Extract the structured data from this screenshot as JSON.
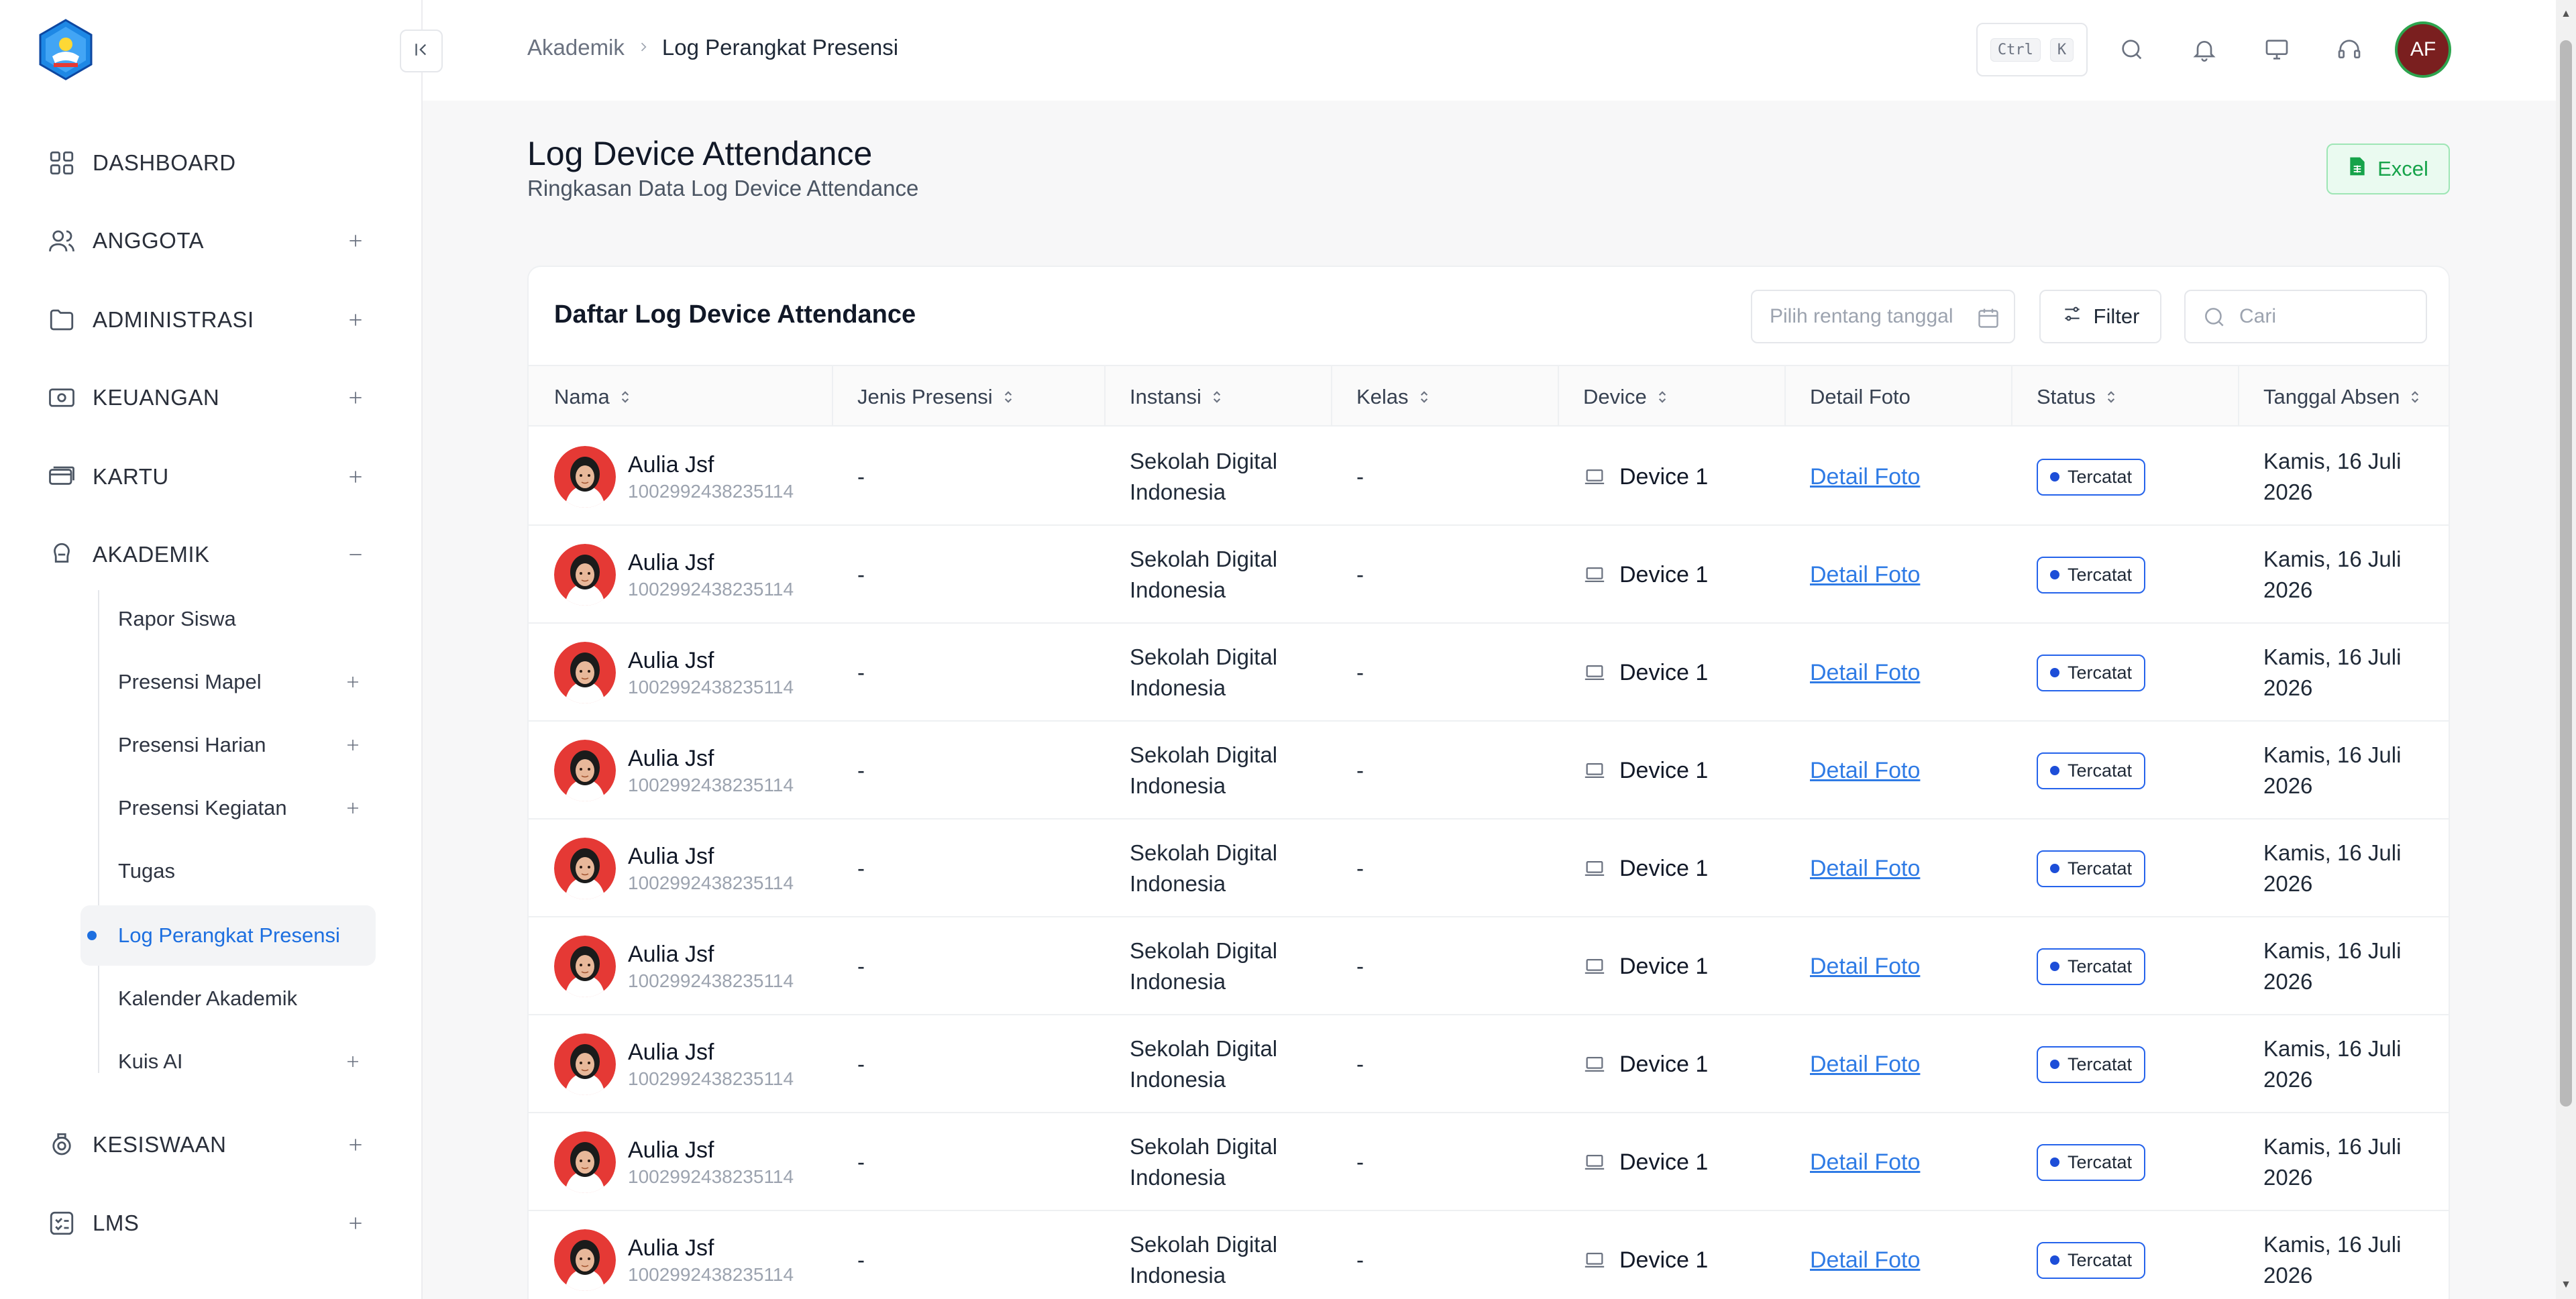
{
  "sidebar": {
    "items": [
      {
        "key": "dashboard",
        "label": "DASHBOARD",
        "expandable": false
      },
      {
        "key": "anggota",
        "label": "ANGGOTA",
        "expandable": true
      },
      {
        "key": "administrasi",
        "label": "ADMINISTRASI",
        "expandable": true
      },
      {
        "key": "keuangan",
        "label": "KEUANGAN",
        "expandable": true
      },
      {
        "key": "kartu",
        "label": "KARTU",
        "expandable": true
      },
      {
        "key": "akademik",
        "label": "AKADEMIK",
        "expandable": true,
        "expanded": true
      },
      {
        "key": "kesiswaan",
        "label": "KESISWAAN",
        "expandable": true
      },
      {
        "key": "lms",
        "label": "LMS",
        "expandable": true
      }
    ],
    "akademik_sub": [
      {
        "label": "Rapor Siswa",
        "expandable": false
      },
      {
        "label": "Presensi Mapel",
        "expandable": true
      },
      {
        "label": "Presensi Harian",
        "expandable": true
      },
      {
        "label": "Presensi Kegiatan",
        "expandable": true
      },
      {
        "label": "Tugas",
        "expandable": false
      },
      {
        "label": "Log Perangkat Presensi",
        "expandable": false,
        "active": true
      },
      {
        "label": "Kalender Akademik",
        "expandable": false
      },
      {
        "label": "Kuis AI",
        "expandable": true
      }
    ]
  },
  "topbar": {
    "breadcrumb": [
      "Akademik",
      "Log Perangkat Presensi"
    ],
    "shortcut": [
      "Ctrl",
      "K"
    ],
    "avatar_initials": "AF"
  },
  "page": {
    "title": "Log Device Attendance",
    "subtitle": "Ringkasan Data Log Device Attendance",
    "excel_label": "Excel"
  },
  "table": {
    "title": "Daftar Log Device Attendance",
    "date_placeholder": "Pilih rentang tanggal",
    "filter_label": "Filter",
    "search_placeholder": "Cari",
    "columns": [
      "Nama",
      "Jenis Presensi",
      "Instansi",
      "Kelas",
      "Device",
      "Detail Foto",
      "Status",
      "Tanggal Absen"
    ],
    "rows": [
      {
        "name": "Aulia Jsf",
        "id": "1002992438235114",
        "jenis": "-",
        "instansi": [
          "Sekolah Digital",
          "Indonesia"
        ],
        "kelas": "-",
        "device": "Device 1",
        "foto": "Detail Foto",
        "status": "Tercatat",
        "tanggal": [
          "Kamis, 16 Juli",
          "2026"
        ]
      },
      {
        "name": "Aulia Jsf",
        "id": "1002992438235114",
        "jenis": "-",
        "instansi": [
          "Sekolah Digital",
          "Indonesia"
        ],
        "kelas": "-",
        "device": "Device 1",
        "foto": "Detail Foto",
        "status": "Tercatat",
        "tanggal": [
          "Kamis, 16 Juli",
          "2026"
        ]
      },
      {
        "name": "Aulia Jsf",
        "id": "1002992438235114",
        "jenis": "-",
        "instansi": [
          "Sekolah Digital",
          "Indonesia"
        ],
        "kelas": "-",
        "device": "Device 1",
        "foto": "Detail Foto",
        "status": "Tercatat",
        "tanggal": [
          "Kamis, 16 Juli",
          "2026"
        ]
      },
      {
        "name": "Aulia Jsf",
        "id": "1002992438235114",
        "jenis": "-",
        "instansi": [
          "Sekolah Digital",
          "Indonesia"
        ],
        "kelas": "-",
        "device": "Device 1",
        "foto": "Detail Foto",
        "status": "Tercatat",
        "tanggal": [
          "Kamis, 16 Juli",
          "2026"
        ]
      },
      {
        "name": "Aulia Jsf",
        "id": "1002992438235114",
        "jenis": "-",
        "instansi": [
          "Sekolah Digital",
          "Indonesia"
        ],
        "kelas": "-",
        "device": "Device 1",
        "foto": "Detail Foto",
        "status": "Tercatat",
        "tanggal": [
          "Kamis, 16 Juli",
          "2026"
        ]
      },
      {
        "name": "Aulia Jsf",
        "id": "1002992438235114",
        "jenis": "-",
        "instansi": [
          "Sekolah Digital",
          "Indonesia"
        ],
        "kelas": "-",
        "device": "Device 1",
        "foto": "Detail Foto",
        "status": "Tercatat",
        "tanggal": [
          "Kamis, 16 Juli",
          "2026"
        ]
      },
      {
        "name": "Aulia Jsf",
        "id": "1002992438235114",
        "jenis": "-",
        "instansi": [
          "Sekolah Digital",
          "Indonesia"
        ],
        "kelas": "-",
        "device": "Device 1",
        "foto": "Detail Foto",
        "status": "Tercatat",
        "tanggal": [
          "Kamis, 16 Juli",
          "2026"
        ]
      },
      {
        "name": "Aulia Jsf",
        "id": "1002992438235114",
        "jenis": "-",
        "instansi": [
          "Sekolah Digital",
          "Indonesia"
        ],
        "kelas": "-",
        "device": "Device 1",
        "foto": "Detail Foto",
        "status": "Tercatat",
        "tanggal": [
          "Kamis, 16 Juli",
          "2026"
        ]
      },
      {
        "name": "Aulia Jsf",
        "id": "1002992438235114",
        "jenis": "-",
        "instansi": [
          "Sekolah Digital",
          "Indonesia"
        ],
        "kelas": "-",
        "device": "Device 1",
        "foto": "Detail Foto",
        "status": "Tercatat",
        "tanggal": [
          "Kamis, 16 Juli",
          "2026"
        ]
      }
    ]
  },
  "colors": {
    "accent": "#1d6fe0",
    "excel_green": "#16a34a",
    "status_border": "#2563eb",
    "avatar_bg": "#7a1f1f",
    "photo_bg": "#e53935"
  }
}
